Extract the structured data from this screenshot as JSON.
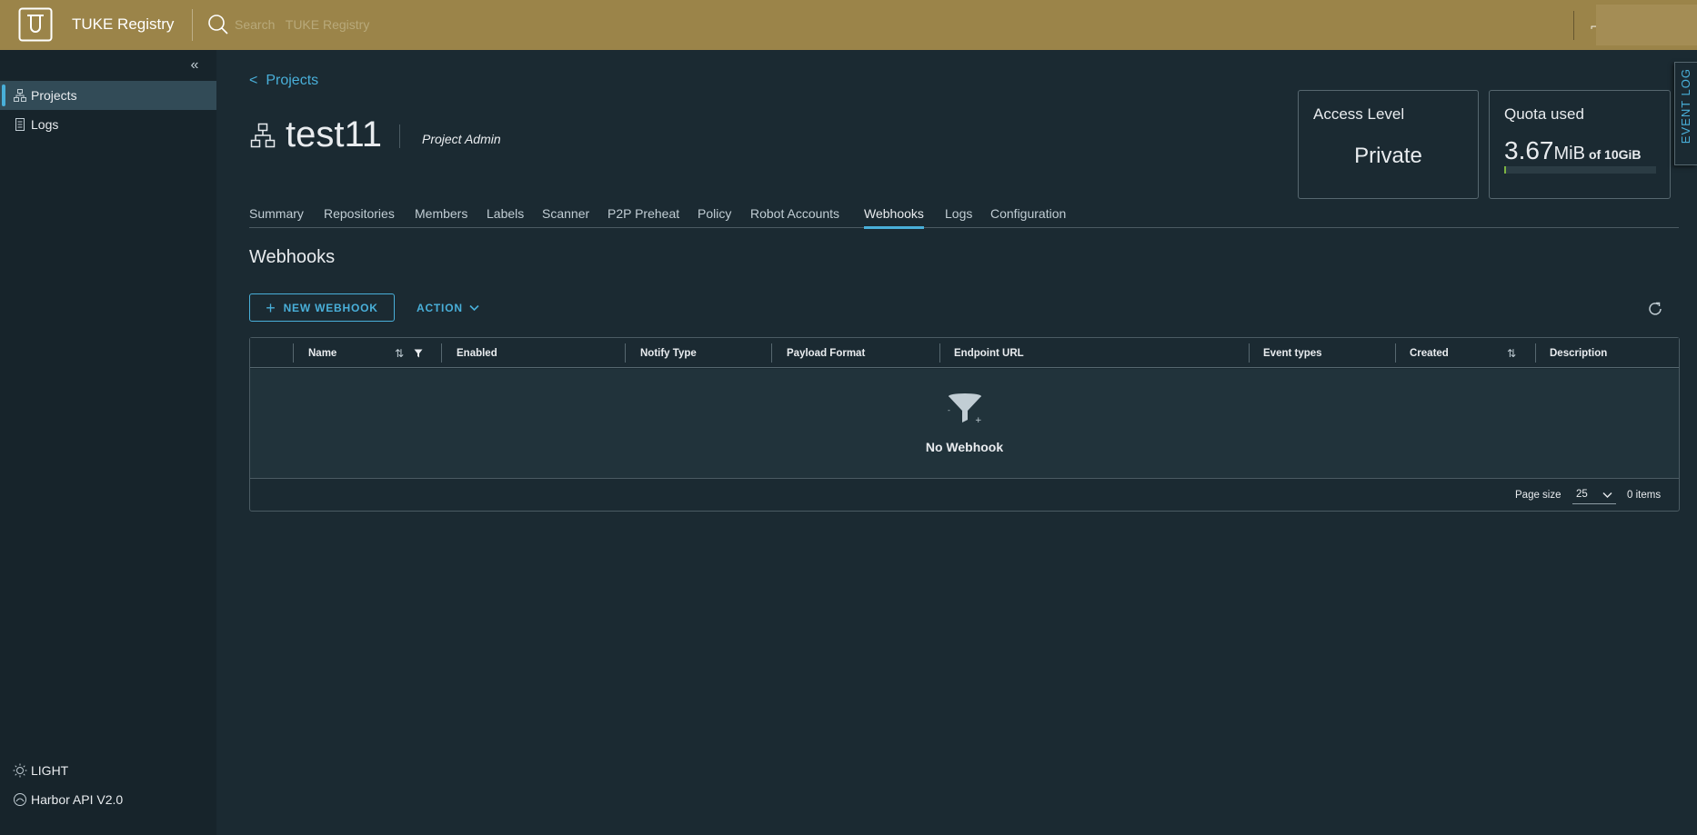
{
  "header": {
    "brand": "TUKE Registry",
    "search_placeholder": "Search   TUKE Registry",
    "accent_color": "#9b8449"
  },
  "sidebar": {
    "items": [
      {
        "label": "Projects",
        "icon": "projects-icon",
        "active": true
      },
      {
        "label": "Logs",
        "icon": "logs-icon",
        "active": false
      }
    ],
    "theme_toggle": "LIGHT",
    "api_link": "Harbor API V2.0"
  },
  "breadcrumb": {
    "label": "Projects"
  },
  "project": {
    "name": "test11",
    "role": "Project Admin"
  },
  "cards": {
    "access": {
      "title": "Access Level",
      "value": "Private"
    },
    "quota": {
      "title": "Quota used",
      "used": "3.67",
      "used_unit": "MiB",
      "of_label": "of 10GiB",
      "fraction": 0.00036
    }
  },
  "event_log": "EVENT LOG",
  "tabs": [
    "Summary",
    "Repositories",
    "Members",
    "Labels",
    "Scanner",
    "P2P Preheat",
    "Policy",
    "Robot Accounts",
    "Webhooks",
    "Logs",
    "Configuration"
  ],
  "active_tab": "Webhooks",
  "section_title": "Webhooks",
  "toolbar": {
    "new_label": "NEW WEBHOOK",
    "action_label": "ACTION"
  },
  "table": {
    "columns": [
      "Name",
      "Enabled",
      "Notify Type",
      "Payload Format",
      "Endpoint URL",
      "Event types",
      "Created",
      "Description"
    ],
    "empty_text": "No Webhook",
    "page_size_label": "Page size",
    "page_size_value": "25",
    "items_label": "0 items"
  }
}
